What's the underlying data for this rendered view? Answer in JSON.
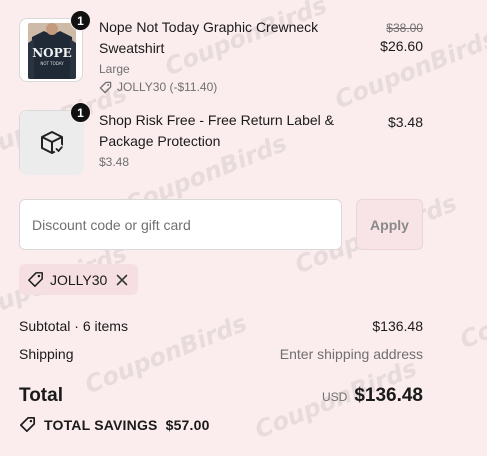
{
  "watermark": "CouponBirds",
  "items": [
    {
      "quantity": "1",
      "title": "Nope Not Today Graphic Crewneck Sweatshirt",
      "variant": "Large",
      "discount": "JOLLY30 (-$11.40)",
      "original_price": "$38.00",
      "price": "$26.60",
      "thumbnail_text_top": "NOPE",
      "thumbnail_text_bottom": "NOT TODAY"
    },
    {
      "quantity": "1",
      "title": "Shop Risk Free - Free Return Label & Package Protection",
      "variant": "$3.48",
      "price": "$3.48"
    }
  ],
  "discount_form": {
    "placeholder": "Discount code or gift card",
    "apply_label": "Apply"
  },
  "applied_code": {
    "code": "JOLLY30"
  },
  "summary": {
    "subtotal_label": "Subtotal · 6 items",
    "subtotal_value": "$136.48",
    "shipping_label": "Shipping",
    "shipping_value": "Enter shipping address",
    "total_label": "Total",
    "total_currency": "USD",
    "total_value": "$136.48",
    "savings_label": "TOTAL SAVINGS",
    "savings_value": "$57.00"
  },
  "colors": {
    "background": "#fbecee",
    "apply_button_bg": "#f8e3e6",
    "chip_bg": "#f6dfe2"
  }
}
